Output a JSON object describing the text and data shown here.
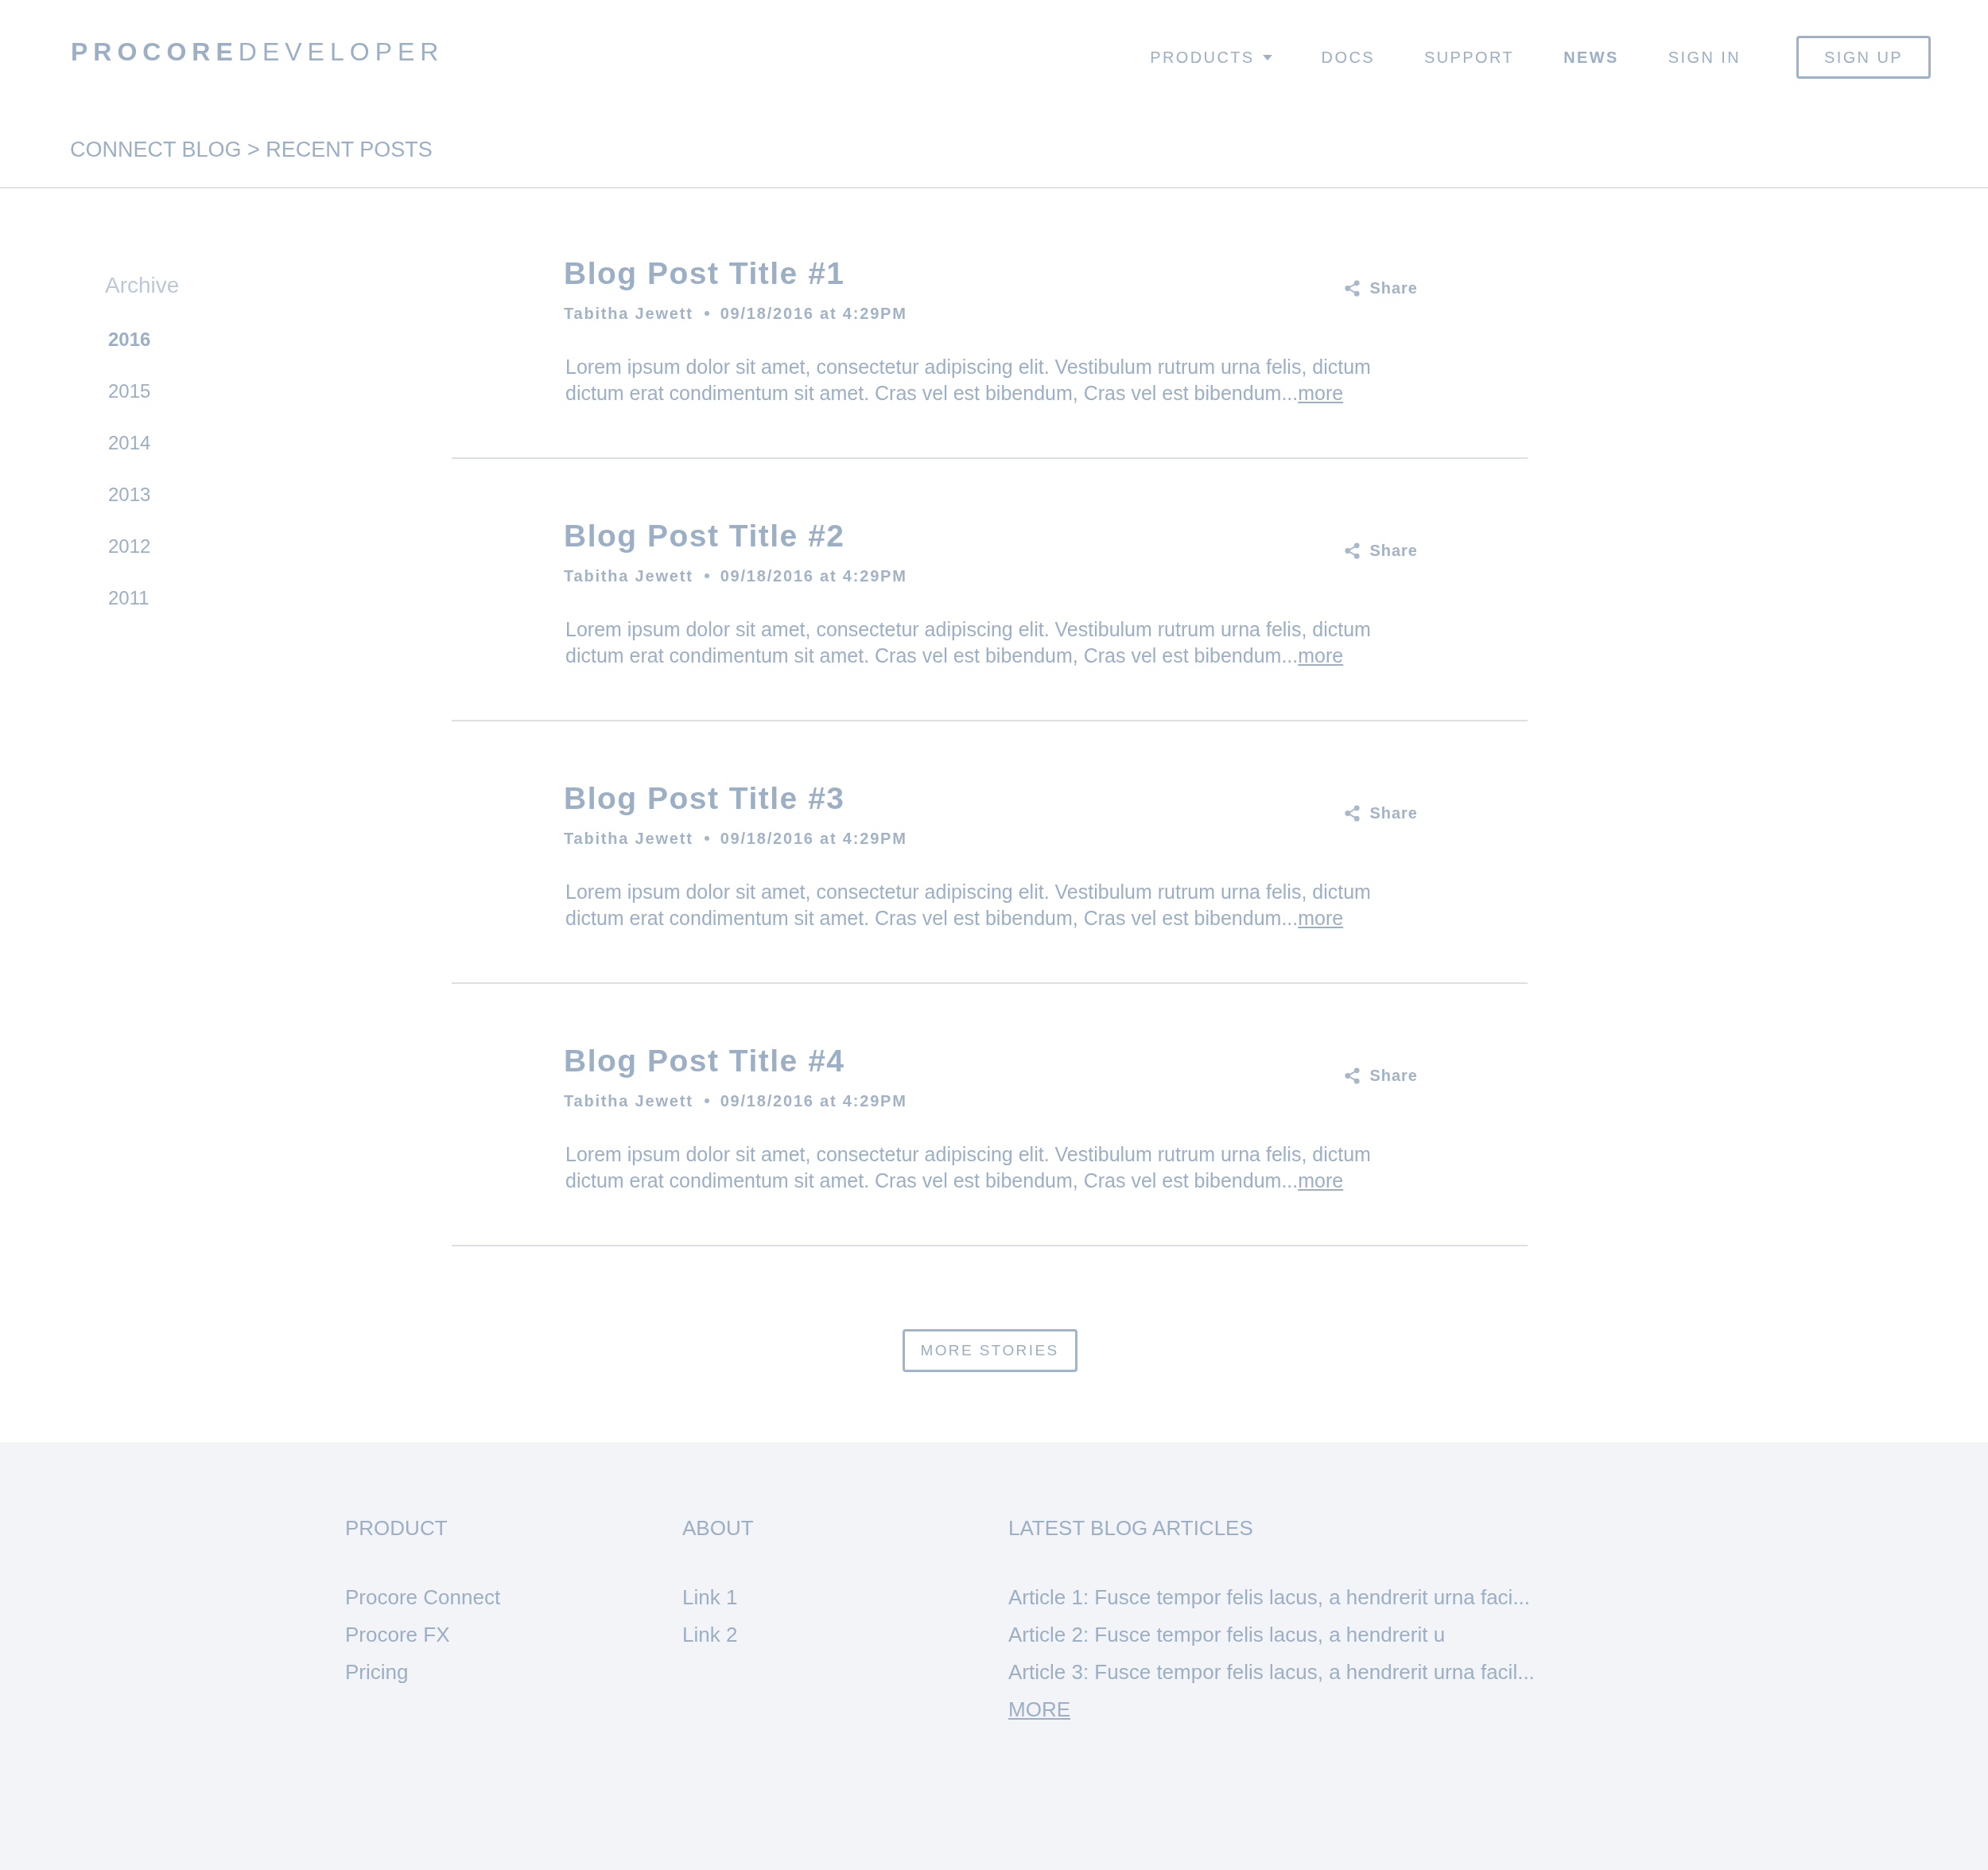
{
  "header": {
    "logo": {
      "brand": "PROCORE",
      "product": "DEVELOPER"
    },
    "nav": [
      {
        "label": "PRODUCTS",
        "kind": "dropdown",
        "selected": false
      },
      {
        "label": "DOCS",
        "kind": "link",
        "selected": false
      },
      {
        "label": "SUPPORT",
        "kind": "link",
        "selected": false
      },
      {
        "label": "NEWS",
        "kind": "link",
        "selected": true
      },
      {
        "label": "SIGN IN",
        "kind": "link",
        "selected": false
      }
    ],
    "signup_button": "SIGN UP"
  },
  "breadcrumb": "CONNECT BLOG > RECENT POSTS",
  "sidebar": {
    "title": "Archive",
    "years": [
      {
        "label": "2016",
        "selected": true
      },
      {
        "label": "2015",
        "selected": false
      },
      {
        "label": "2014",
        "selected": false
      },
      {
        "label": "2013",
        "selected": false
      },
      {
        "label": "2012",
        "selected": false
      },
      {
        "label": "2011",
        "selected": false
      }
    ]
  },
  "posts": [
    {
      "title": "Blog Post Title #1",
      "author": "Tabitha Jewett",
      "date": "09/18/2016 at 4:29PM",
      "share": "Share",
      "excerpt": "Lorem ipsum dolor sit amet, consectetur adipiscing elit. Vestibulum rutrum urna felis, dictum dictum erat condimentum sit amet. Cras vel est bibendum, Cras vel est bibendum...",
      "more_link": "more"
    },
    {
      "title": "Blog Post Title #2",
      "author": "Tabitha Jewett",
      "date": "09/18/2016 at 4:29PM",
      "share": "Share",
      "excerpt": "Lorem ipsum dolor sit amet, consectetur adipiscing elit. Vestibulum rutrum urna felis, dictum dictum erat condimentum sit amet. Cras vel est bibendum, Cras vel est bibendum...",
      "more_link": "more"
    },
    {
      "title": "Blog Post Title #3",
      "author": "Tabitha Jewett",
      "date": "09/18/2016 at 4:29PM",
      "share": "Share",
      "excerpt": "Lorem ipsum dolor sit amet, consectetur adipiscing elit. Vestibulum rutrum urna felis, dictum dictum erat condimentum sit amet. Cras vel est bibendum, Cras vel est bibendum...",
      "more_link": "more"
    },
    {
      "title": "Blog Post Title #4",
      "author": "Tabitha Jewett",
      "date": "09/18/2016 at 4:29PM",
      "share": "Share",
      "excerpt": "Lorem ipsum dolor sit amet, consectetur adipiscing elit. Vestibulum rutrum urna felis, dictum dictum erat condimentum sit amet. Cras vel est bibendum, Cras vel est bibendum...",
      "more_link": "more"
    }
  ],
  "more_stories_button": "MORE STORIES",
  "footer": {
    "columns": [
      {
        "heading": "PRODUCT",
        "links": [
          "Procore Connect",
          "Procore FX",
          "Pricing"
        ]
      },
      {
        "heading": "ABOUT",
        "links": [
          "Link 1",
          "Link 2"
        ]
      },
      {
        "heading": "LATEST BLOG ARTICLES",
        "links": [
          "Article 1: Fusce tempor felis lacus, a hendrerit urna faci...",
          "Article 2: Fusce tempor felis lacus, a hendrerit u",
          "Article 3: Fusce tempor felis lacus, a hendrerit urna facil..."
        ],
        "more_link": "MORE"
      }
    ]
  }
}
